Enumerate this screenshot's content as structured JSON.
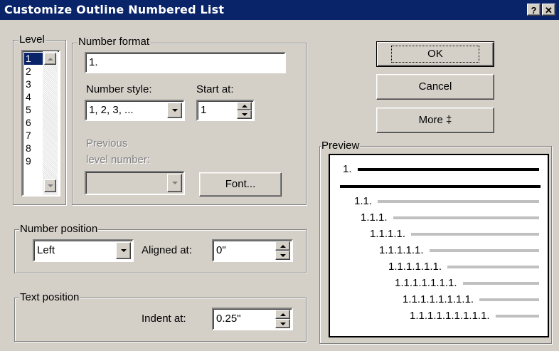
{
  "window": {
    "title": "Customize Outline Numbered List",
    "help_label": "?",
    "close_label": "✕"
  },
  "level": {
    "label": "Level",
    "items": [
      "1",
      "2",
      "3",
      "4",
      "5",
      "6",
      "7",
      "8",
      "9"
    ],
    "selected_index": 0
  },
  "number_format": {
    "group_label": "Number format",
    "format_value": "1.",
    "number_style_label": "Number style:",
    "number_style_value": "1, 2, 3, ...",
    "start_at_label": "Start at:",
    "start_at_value": "1",
    "previous_level_label_line1": "Previous",
    "previous_level_label_line2": "level number:",
    "previous_level_value": "",
    "font_button_label": "Font..."
  },
  "number_position": {
    "group_label": "Number position",
    "alignment_value": "Left",
    "aligned_at_label": "Aligned at:",
    "aligned_at_value": "0\""
  },
  "text_position": {
    "group_label": "Text position",
    "indent_at_label": "Indent at:",
    "indent_at_value": "0.25\""
  },
  "buttons": {
    "ok": "OK",
    "cancel": "Cancel",
    "more": "More ‡"
  },
  "preview": {
    "label": "Preview",
    "items": [
      "1.",
      "1.1.",
      "1.1.1.",
      "1.1.1.1.",
      "1.1.1.1.1.",
      "1.1.1.1.1.1.",
      "1.1.1.1.1.1.1.",
      "1.1.1.1.1.1.1.1.",
      "1.1.1.1.1.1.1.1.1."
    ]
  }
}
